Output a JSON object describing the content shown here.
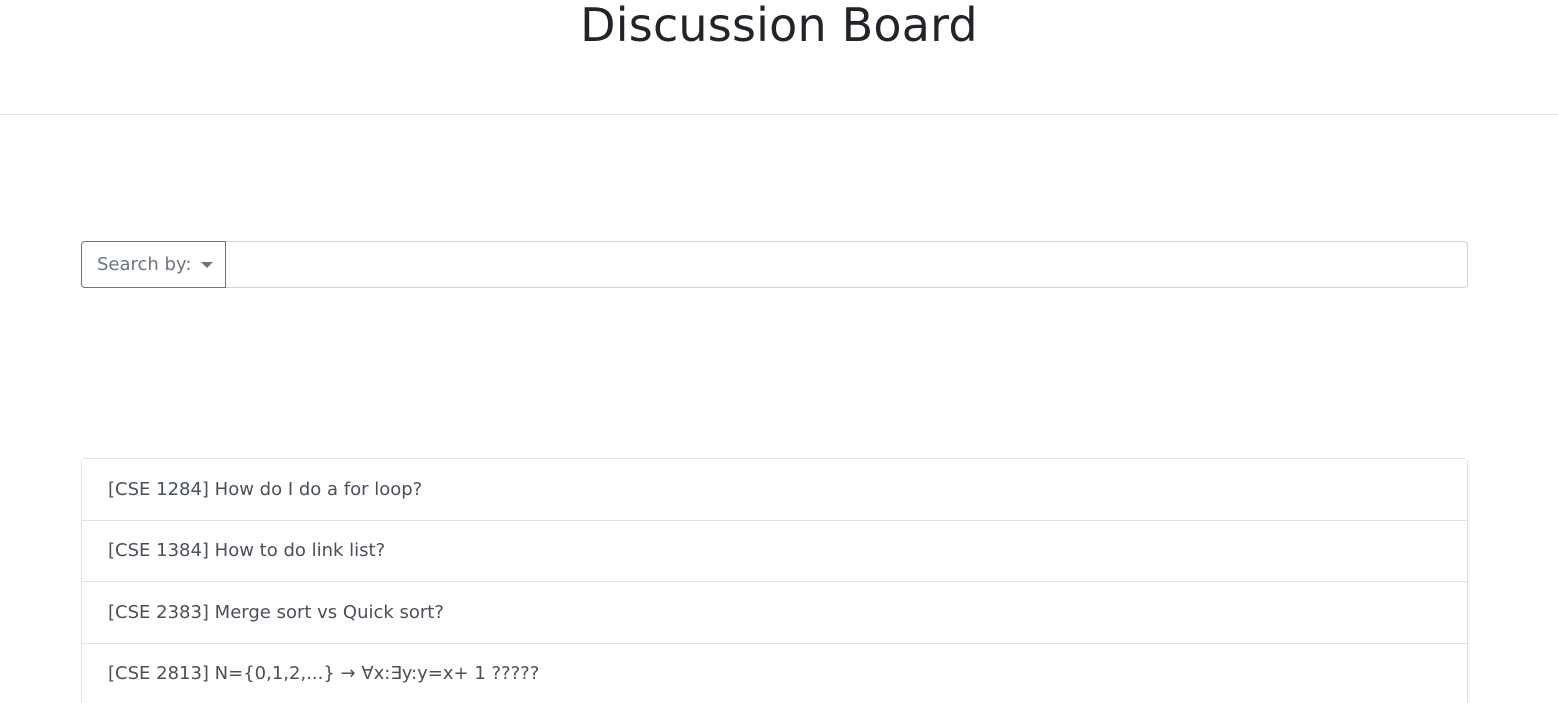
{
  "header": {
    "title": "Discussion Board"
  },
  "search": {
    "dropdown_label": "Search by:",
    "input_value": "",
    "placeholder": ""
  },
  "posts": [
    {
      "title": "[CSE 1284] How do I do a for loop?"
    },
    {
      "title": "[CSE 1384] How to do link list?"
    },
    {
      "title": "[CSE 2383] Merge sort vs Quick sort?"
    },
    {
      "title": "[CSE 2813] N={0,1,2,...} → ∀x:∃y:y=x+ 1 ?????"
    }
  ],
  "colors": {
    "text": "#212529",
    "muted": "#6c757d",
    "border": "#dee2e6"
  }
}
